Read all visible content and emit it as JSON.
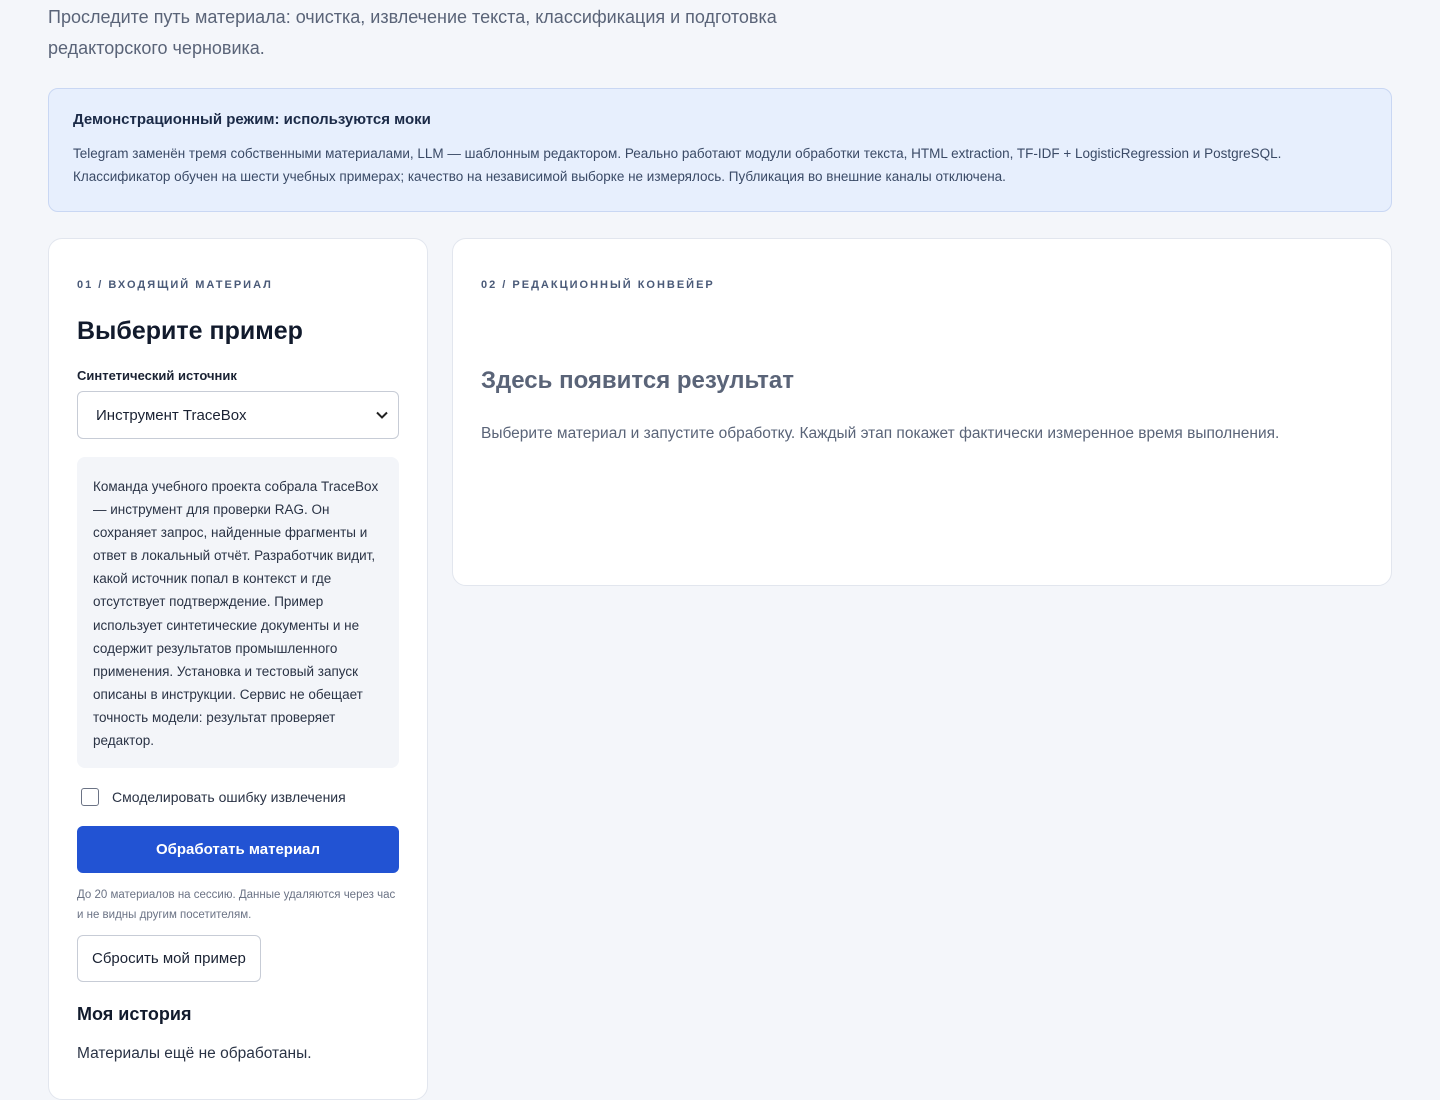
{
  "intro": {
    "text": "Проследите путь материала: очистка, извлечение текста, классификация и подготовка редакторского черновика."
  },
  "banner": {
    "title": "Демонстрационный режим: используются моки",
    "text": "Telegram заменён тремя собственными материалами, LLM — шаблонным редактором. Реально работают модули обработки текста, HTML extraction, TF-IDF + LogisticRegression и PostgreSQL. Классификатор обучен на шести учебных примерах; качество на независимой выборке не измерялось. Публикация во внешние каналы отключена."
  },
  "input_panel": {
    "eyebrow": "01 / Входящий материал",
    "heading": "Выберите пример",
    "source_label": "Синтетический источник",
    "source_selected": "Инструмент TraceBox",
    "description": "Команда учебного проекта собрала TraceBox — инструмент для проверки RAG. Он сохраняет запрос, найденные фрагменты и ответ в локальный отчёт. Разработчик видит, какой источник попал в контекст и где отсутствует подтверждение. Пример использует синтетические документы и не содержит результатов промышленного применения. Установка и тестовый запуск описаны в инструкции. Сервис не обещает точность модели: результат проверяет редактор.",
    "simulate_error_label": "Смоделировать ошибку извлечения",
    "simulate_error_checked": false,
    "process_button": "Обработать материал",
    "limit_hint": "До 20 материалов на сессию. Данные удаляются через час и не видны другим посетителям.",
    "reset_button": "Сбросить мой пример",
    "history_heading": "Моя история",
    "history_empty": "Материалы ещё не обработаны."
  },
  "pipeline_panel": {
    "eyebrow": "02 / Редакционный конвейер",
    "placeholder_title": "Здесь появится результат",
    "placeholder_text": "Выберите материал и запустите обработку. Каждый этап покажет фактически измеренное время выполнения."
  },
  "icons": {
    "select_chevron": "chevron-down-icon"
  },
  "colors": {
    "primary": "#2253d3",
    "banner_bg": "#e7effd",
    "page_bg": "#f4f6fa"
  }
}
